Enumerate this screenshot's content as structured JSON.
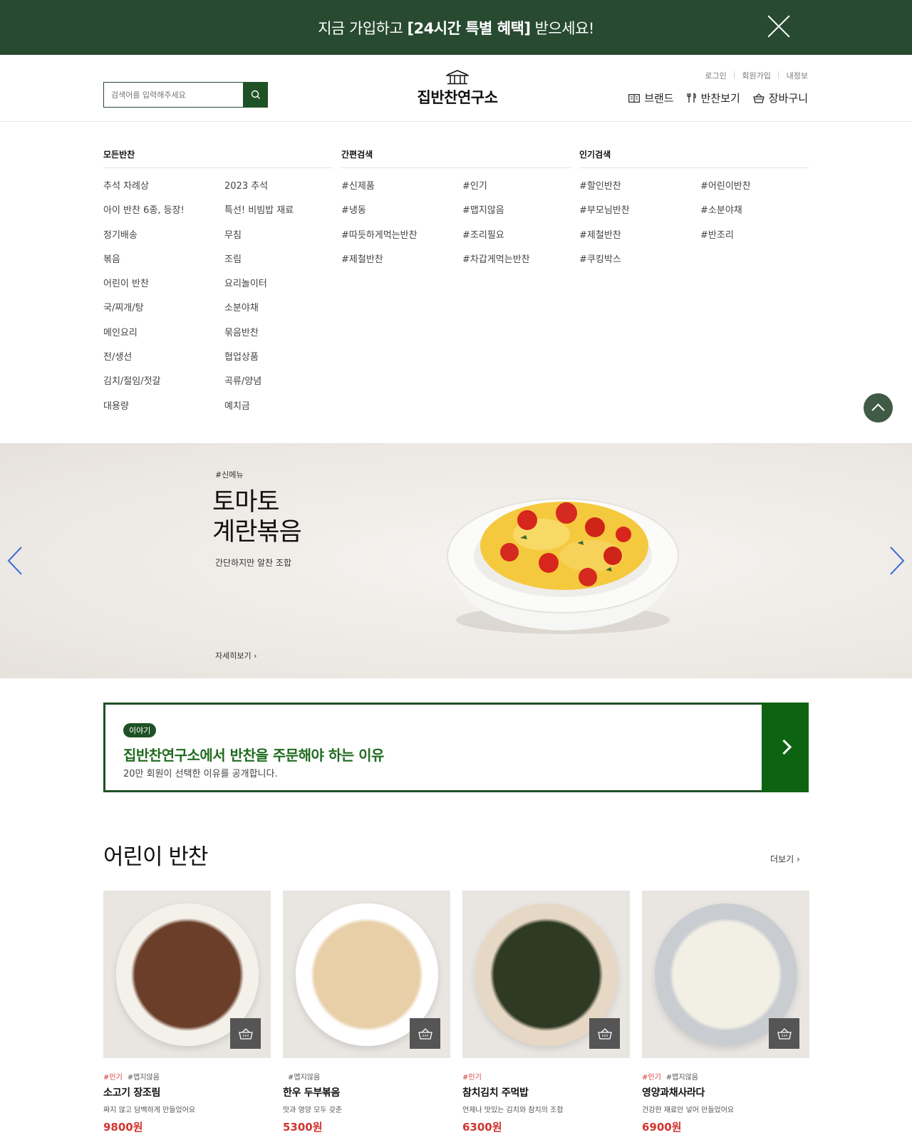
{
  "promo": {
    "text_pre": "지금 가입하고 ",
    "text_bold": "[24시간 특별 혜택]",
    "text_post": " 받으세요!"
  },
  "search": {
    "placeholder": "검색어를 입력해주세요"
  },
  "logo": {
    "text": "집반찬연구소"
  },
  "util_links": [
    "로그인",
    "회원가입",
    "내정보"
  ],
  "main_nav": [
    {
      "label": "브랜드",
      "icon": "book-icon"
    },
    {
      "label": "반찬보기",
      "icon": "utensils-icon"
    },
    {
      "label": "장바구니",
      "icon": "basket-icon"
    }
  ],
  "menu": {
    "all": {
      "title": "모든반찬",
      "col1": [
        "추석 차례상",
        "아이 반찬 6종, 등장!",
        "정기배송",
        "볶음",
        "어린이 반찬",
        "국/찌개/탕",
        "메인요리",
        "전/생선",
        "김치/절임/젓갈",
        "대용량"
      ],
      "col2": [
        "2023 추석",
        "특선! 비빔밥 재료",
        "무침",
        "조림",
        "요리놀이터",
        "소분야채",
        "묶음반찬",
        "협업상품",
        "곡류/양념",
        "예치금"
      ]
    },
    "quick": {
      "title": "간편검색",
      "col1": [
        "#신제품",
        "#냉동",
        "#따듯하게먹는반찬",
        "#제철반찬"
      ],
      "col2": [
        "#인기",
        "#맵지않음",
        "#조리필요",
        "#차갑게먹는반찬"
      ]
    },
    "popular": {
      "title": "인기검색",
      "col1": [
        "#할인반찬",
        "#부모님반찬",
        "#제철반찬",
        "#쿠킹박스"
      ],
      "col2": [
        "#어린이반찬",
        "#소분야채",
        "#반조리"
      ]
    }
  },
  "hero": {
    "tag": "#신메뉴",
    "title_line1": "토마토",
    "title_line2": "계란볶음",
    "subtitle": "간단하지만 알찬 조합",
    "more": "자세히보기"
  },
  "story": {
    "badge": "이야기",
    "title": "집반찬연구소에서 반찬을 주문해야 하는 이유",
    "subtitle": "20만 회원이 선택한 이유를 공개합니다."
  },
  "section": {
    "title": "어린이 반찬",
    "more": "더보기"
  },
  "products": [
    {
      "tag_hot": "#인기",
      "tag": "#맵지않음",
      "name": "소고기 장조림",
      "desc": "짜지 않고 담백하게 만들었어요",
      "price": "9800원",
      "plate": "#f4f1ea",
      "food": "#6b3e2a"
    },
    {
      "tag_hot": "",
      "tag": "#맵지않음",
      "name": "한우 두부볶음",
      "desc": "맛과 영양 모두 갖춘",
      "price": "5300원",
      "plate": "#ffffff",
      "food": "#e8cfa8"
    },
    {
      "tag_hot": "#인기",
      "tag": "",
      "name": "참치김치 주먹밥",
      "desc": "언제나 맛있는 김치와 참치의 조합",
      "price": "6300원",
      "plate": "#e6d8c4",
      "food": "#2e3a24"
    },
    {
      "tag_hot": "#인기",
      "tag": "#맵지않음",
      "name": "영양과채사라다",
      "desc": "건강한 재료만 넣어 만들었어요",
      "price": "6900원",
      "plate": "#c9cdd1",
      "food": "#f2efe4"
    }
  ]
}
